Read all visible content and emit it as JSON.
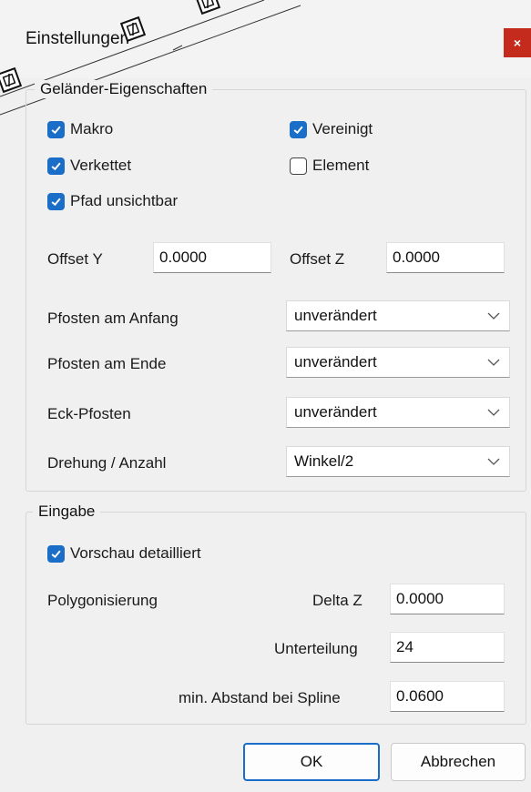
{
  "window": {
    "title": "Einstellungen",
    "close_glyph": "×"
  },
  "railing": {
    "legend": "Geländer-Eigenschaften",
    "checkboxes": [
      {
        "label": "Makro",
        "checked": true
      },
      {
        "label": "Vereinigt",
        "checked": true
      },
      {
        "label": "Verkettet",
        "checked": true
      },
      {
        "label": "Element",
        "checked": false
      },
      {
        "label": "Pfad unsichtbar",
        "checked": true
      }
    ],
    "offset_y": {
      "label": "Offset Y",
      "value": "0.0000"
    },
    "offset_z": {
      "label": "Offset Z",
      "value": "0.0000"
    },
    "dropdowns": [
      {
        "label": "Pfosten am Anfang",
        "value": "unverändert"
      },
      {
        "label": "Pfosten am Ende",
        "value": "unverändert"
      },
      {
        "label": "Eck-Pfosten",
        "value": "unverändert"
      },
      {
        "label": "Drehung / Anzahl",
        "value": "Winkel/2"
      }
    ]
  },
  "input_group": {
    "legend": "Eingabe",
    "preview": {
      "label": "Vorschau detailliert",
      "checked": true
    },
    "polygonization_label": "Polygonisierung",
    "delta_z": {
      "label": "Delta Z",
      "value": "0.0000"
    },
    "subdivision": {
      "label": "Unterteilung",
      "value": "24"
    },
    "min_distance": {
      "label": "min. Abstand bei Spline",
      "value": "0.0600"
    }
  },
  "buttons": {
    "ok": "OK",
    "cancel": "Abbrechen"
  },
  "colors": {
    "accent": "#1a6ec8",
    "close": "#c42b1c",
    "background": "#f0f0f0"
  }
}
